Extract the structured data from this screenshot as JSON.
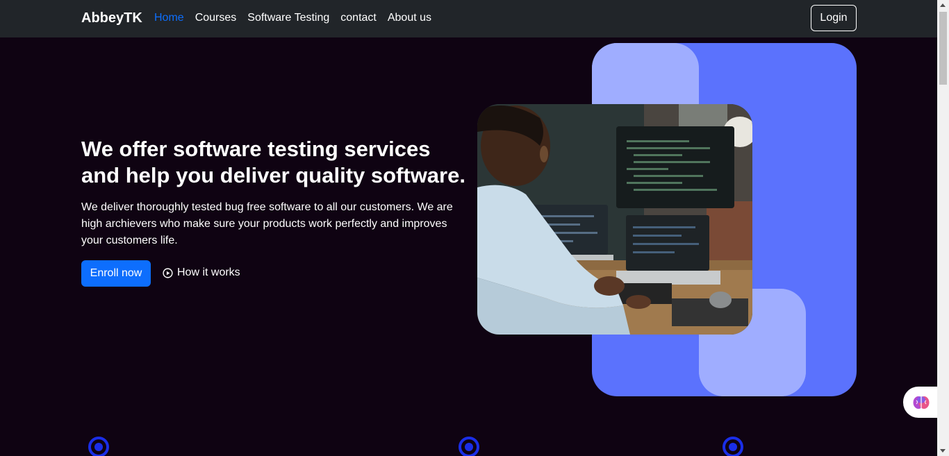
{
  "nav": {
    "brand": "AbbeyTK",
    "links": [
      {
        "label": "Home",
        "active": true
      },
      {
        "label": "Courses",
        "active": false
      },
      {
        "label": "Software Testing",
        "active": false
      },
      {
        "label": "contact",
        "active": false
      },
      {
        "label": "About us",
        "active": false
      }
    ],
    "login_label": "Login"
  },
  "hero": {
    "title": "We offer software testing services and help you deliver quality software.",
    "description": "We deliver thoroughly tested bug free software to all our customers. We are high archievers who make sure your products work perfectly and improves your customers life.",
    "enroll_label": "Enroll now",
    "how_label": "How it works",
    "image_icon": "person-coding-photo"
  },
  "widget": {
    "icon": "brain-icon"
  },
  "colors": {
    "background": "#0f0312",
    "navbar": "#212529",
    "accent": "#0d6efd",
    "shape_dark": "#5b72fd",
    "shape_light": "#9fadff",
    "ring": "#1a2ee8"
  }
}
